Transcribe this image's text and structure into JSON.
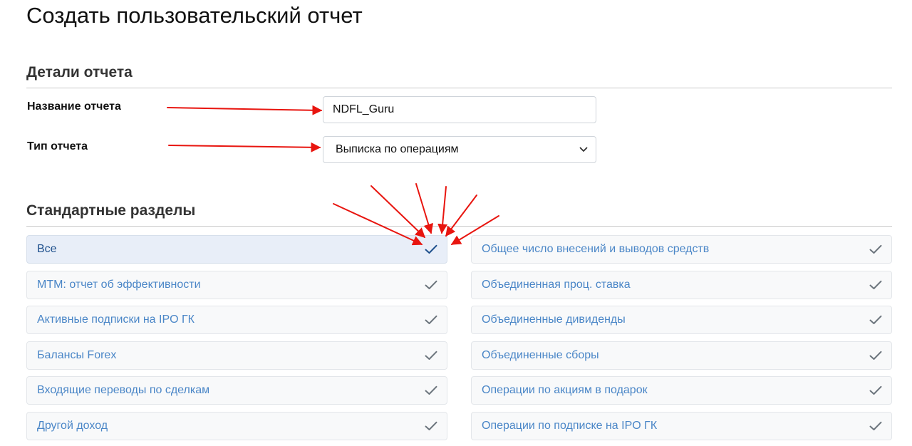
{
  "page": {
    "title": "Создать пользовательский отчет"
  },
  "details": {
    "section_title": "Детали отчета",
    "name_label": "Название отчета",
    "name_value": "NDFL_Guru",
    "type_label": "Тип отчета",
    "type_value": "Выписка по операциям"
  },
  "standard_sections": {
    "section_title": "Стандартные разделы",
    "left": [
      {
        "label": "Все",
        "selected": true
      },
      {
        "label": "MTM: отчет об эффективности",
        "selected": false
      },
      {
        "label": "Активные подписки на IPO ГК",
        "selected": false
      },
      {
        "label": "Балансы Forex",
        "selected": false
      },
      {
        "label": "Входящие переводы по сделкам",
        "selected": false
      },
      {
        "label": "Другой доход",
        "selected": false
      }
    ],
    "right": [
      {
        "label": "Общее число внесений и выводов средств",
        "selected": false
      },
      {
        "label": "Объединенная проц. ставка",
        "selected": false
      },
      {
        "label": "Объединенные дивиденды",
        "selected": false
      },
      {
        "label": "Объединенные сборы",
        "selected": false
      },
      {
        "label": "Операции по акциям в подарок",
        "selected": false
      },
      {
        "label": "Операции по подписке на IPO ГК",
        "selected": false
      }
    ]
  },
  "icons": {
    "checkmark": "check-icon",
    "select_caret": "chevron-down-icon",
    "annotation": "arrow-icon"
  },
  "colors": {
    "option_text": "#4a86c7",
    "selected_text": "#1d4f8c",
    "selected_check": "#1d4f8c",
    "unselected_check": "#6c757d",
    "annotation_arrow": "#e8150f"
  }
}
